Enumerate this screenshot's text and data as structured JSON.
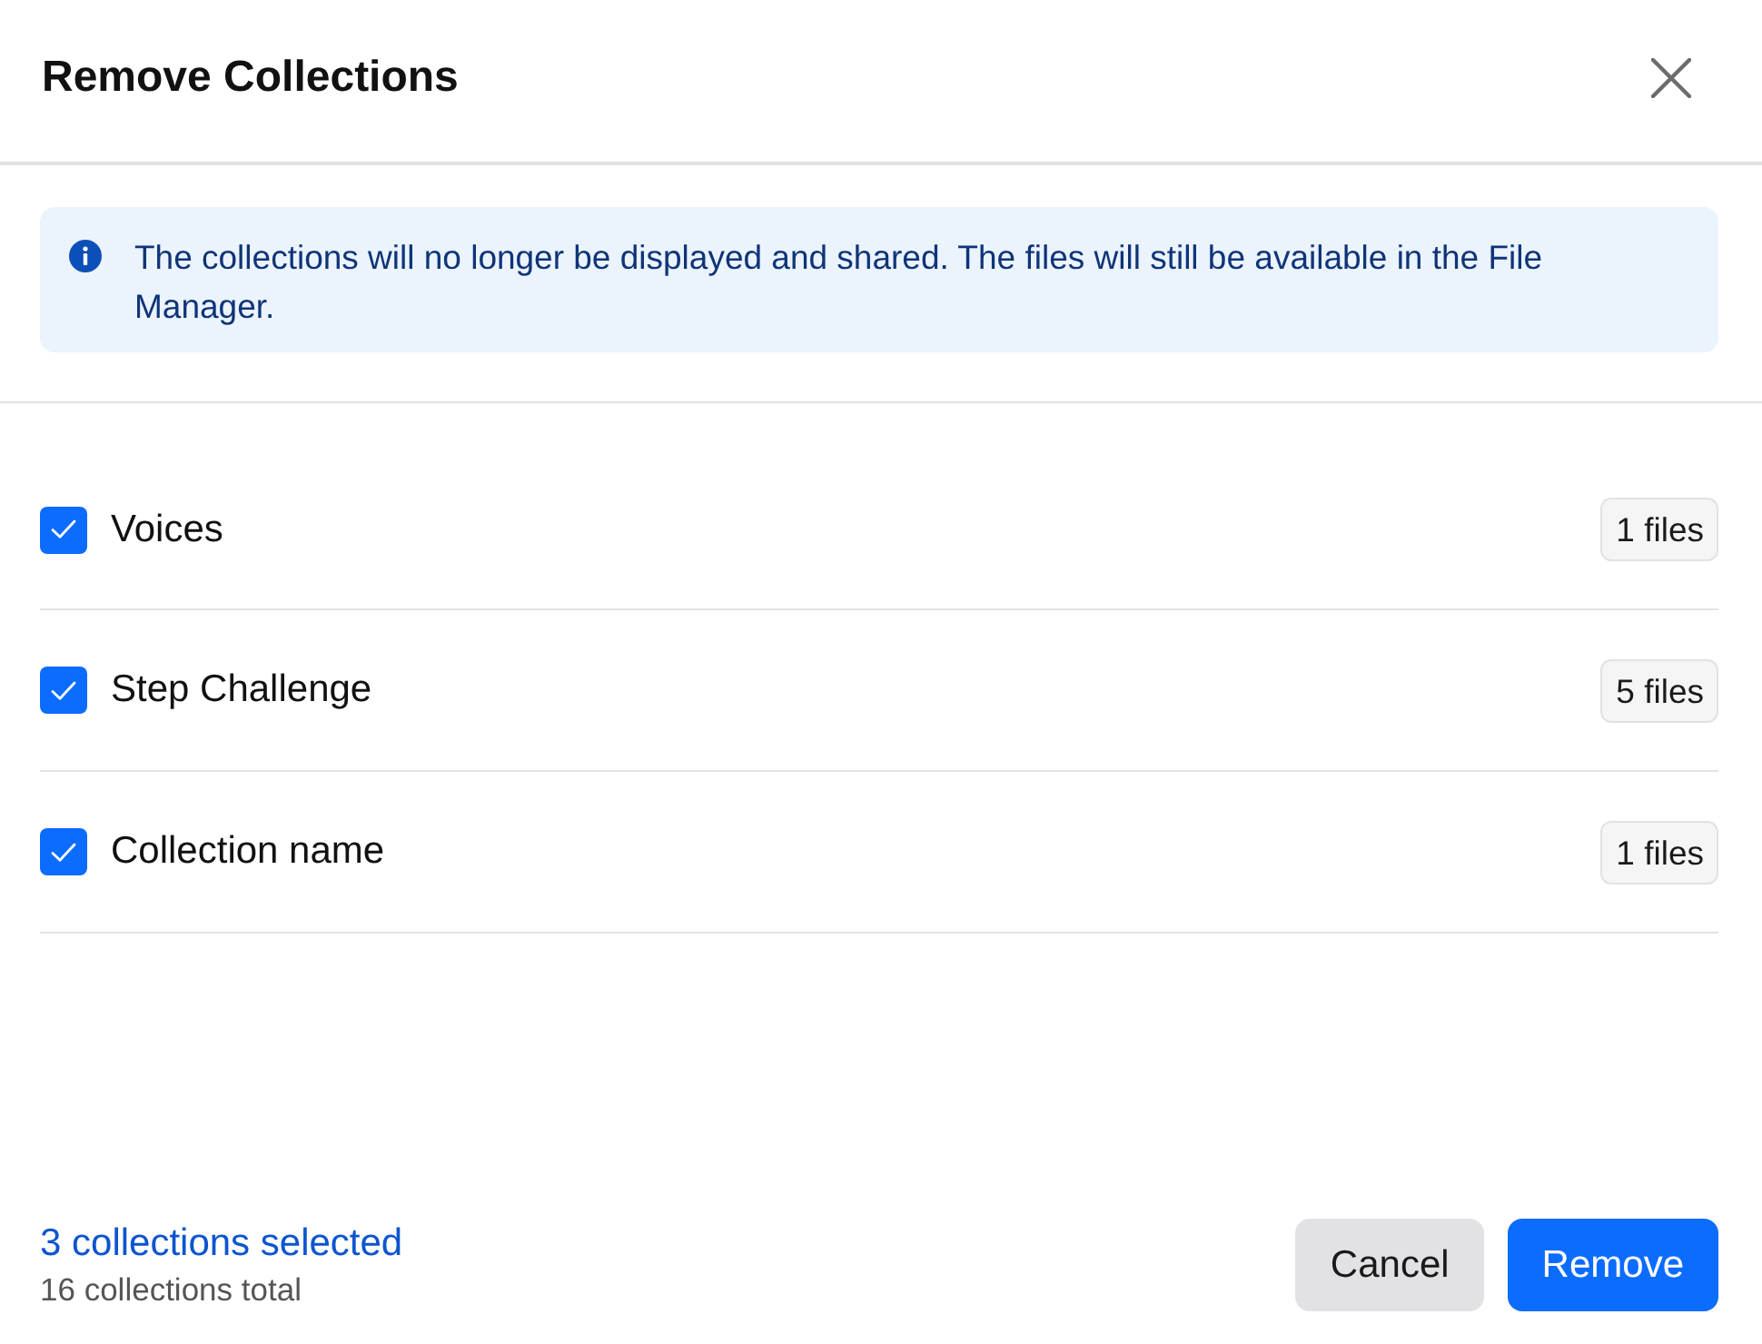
{
  "dialog": {
    "title": "Remove Collections"
  },
  "notice": {
    "text": "The collections will no longer be displayed and shared. The files will still be available in the File Manager."
  },
  "collections": [
    {
      "name": "Voices",
      "count": "1 files",
      "checked": true
    },
    {
      "name": "Step Challenge",
      "count": "5 files",
      "checked": true
    },
    {
      "name": "Collection name",
      "count": "1 files",
      "checked": true
    }
  ],
  "footer": {
    "selected_count": "3 collections selected",
    "total_count": "16 collections total"
  },
  "buttons": [
    {
      "label": "Cancel",
      "kind": "secondary"
    },
    {
      "label": "Remove",
      "kind": "primary"
    }
  ]
}
